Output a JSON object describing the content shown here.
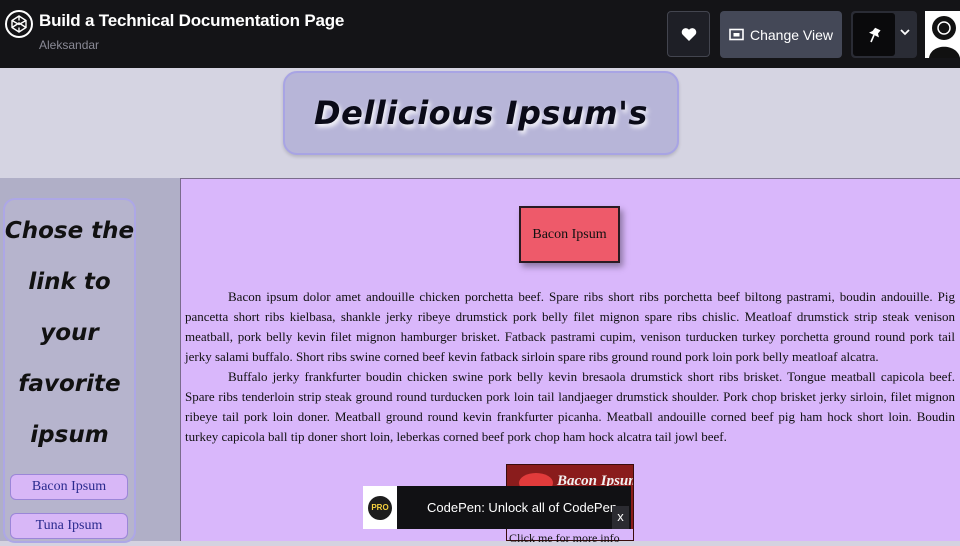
{
  "topbar": {
    "title": "Build a Technical Documentation Page",
    "author": "Aleksandar",
    "heart_icon": "heart-icon",
    "change_view_label": "Change View",
    "pin_icon": "pin-icon",
    "chevron_icon": "chevron-down-icon"
  },
  "header": {
    "title": "Dellicious Ipsum's"
  },
  "sidebar": {
    "heading_lines": [
      "Chose the",
      "link to",
      "your",
      "favorite",
      "ipsum"
    ],
    "links": [
      {
        "label": "Bacon Ipsum"
      },
      {
        "label": "Tuna Ipsum"
      }
    ]
  },
  "main": {
    "section_button_label": "Bacon Ipsum",
    "paragraphs": [
      "Bacon ipsum dolor amet andouille chicken porchetta beef. Spare ribs short ribs porchetta beef biltong pastrami, boudin andouille. Pig pancetta short ribs kielbasa, shankle jerky ribeye drumstick pork belly filet mignon spare ribs chislic. Meatloaf drumstick strip steak venison meatball, pork belly kevin filet mignon hamburger brisket. Fatback pastrami cupim, venison turducken turkey porchetta ground round pork tail jerky salami buffalo. Short ribs swine corned beef kevin fatback sirloin spare ribs ground round pork loin pork belly meatloaf alcatra.",
      "Buffalo jerky frankfurter boudin chicken swine pork belly kevin bresaola drumstick short ribs brisket. Tongue meatball capicola beef. Spare ribs tenderloin strip steak ground round turducken pork loin tail landjaeger drumstick shoulder. Pork chop brisket jerky sirloin, filet mignon ribeye tail pork loin doner. Meatball ground round kevin frankfurter picanha. Meatball andouille corned beef pig ham hock short loin. Boudin turkey capicola ball tip doner short loin, leberkas corned beef pork chop ham hock alcatra tail jowl beef."
    ],
    "image_logo_text": "Bacon Ipsum",
    "image_caption": "Click me for more info"
  },
  "promo": {
    "badge": "PRO",
    "text": "CodePen: Unlock all of CodePen",
    "close_label": "x"
  }
}
